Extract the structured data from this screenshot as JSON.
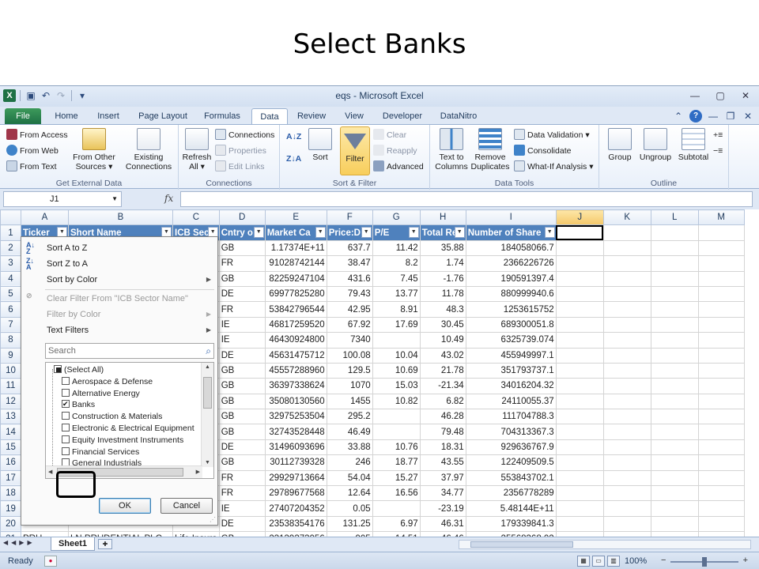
{
  "slide_title": "Select Banks",
  "window": {
    "title": "eqs - Microsoft Excel"
  },
  "ribbon_tabs": [
    "File",
    "Home",
    "Insert",
    "Page Layout",
    "Formulas",
    "Data",
    "Review",
    "View",
    "Developer",
    "DataNitro"
  ],
  "active_tab": "Data",
  "ribbon": {
    "get_external": {
      "label": "Get External Data",
      "from_access": "From Access",
      "from_web": "From Web",
      "from_text": "From Text",
      "from_other_1": "From Other",
      "from_other_2": "Sources ▾",
      "existing_1": "Existing",
      "existing_2": "Connections"
    },
    "connections": {
      "label": "Connections",
      "refresh_1": "Refresh",
      "refresh_2": "All ▾",
      "connections": "Connections",
      "properties": "Properties",
      "edit_links": "Edit Links"
    },
    "sort_filter": {
      "label": "Sort & Filter",
      "sort": "Sort",
      "filter": "Filter",
      "clear": "Clear",
      "reapply": "Reapply",
      "advanced": "Advanced"
    },
    "data_tools": {
      "label": "Data Tools",
      "text_to_1": "Text to",
      "text_to_2": "Columns",
      "remove_1": "Remove",
      "remove_2": "Duplicates",
      "data_validation": "Data Validation ▾",
      "consolidate": "Consolidate",
      "what_if": "What-If Analysis ▾"
    },
    "outline": {
      "label": "Outline",
      "group": "Group",
      "ungroup": "Ungroup",
      "subtotal": "Subtotal"
    }
  },
  "formula_bar": {
    "name_box": "J1",
    "fx": "fx",
    "value": ""
  },
  "columns": [
    "A",
    "B",
    "C",
    "D",
    "E",
    "F",
    "G",
    "H",
    "I",
    "J",
    "K",
    "L",
    "M"
  ],
  "header_row": [
    "Ticker",
    "Short Name",
    "ICB Sec",
    "Cntry o",
    "Market Ca",
    "Price:D",
    "P/E",
    "Total Re",
    "Number of Share"
  ],
  "rows": [
    [
      "",
      "",
      "",
      "GB",
      "1.17374E+11",
      "637.7",
      "11.42",
      "35.88",
      "184058066.7"
    ],
    [
      "",
      "",
      "",
      "FR",
      "91028742144",
      "38.47",
      "8.2",
      "1.74",
      "2366226726"
    ],
    [
      "",
      "",
      "",
      "GB",
      "82259247104",
      "431.6",
      "7.45",
      "-1.76",
      "190591397.4"
    ],
    [
      "",
      "",
      "",
      "DE",
      "69977825280",
      "79.43",
      "13.77",
      "11.78",
      "880999940.6"
    ],
    [
      "",
      "",
      "",
      "FR",
      "53842796544",
      "42.95",
      "8.91",
      "48.3",
      "1253615752"
    ],
    [
      "",
      "",
      "",
      "IE",
      "46817259520",
      "67.92",
      "17.69",
      "30.45",
      "689300051.8"
    ],
    [
      "",
      "",
      "",
      "IE",
      "46430924800",
      "7340",
      "",
      "10.49",
      "6325739.074"
    ],
    [
      "",
      "",
      "",
      "DE",
      "45631475712",
      "100.08",
      "10.04",
      "43.02",
      "455949997.1"
    ],
    [
      "",
      "",
      "",
      "GB",
      "45557288960",
      "129.5",
      "10.69",
      "21.78",
      "351793737.1"
    ],
    [
      "",
      "",
      "",
      "GB",
      "36397338624",
      "1070",
      "15.03",
      "-21.34",
      "34016204.32"
    ],
    [
      "",
      "",
      "",
      "GB",
      "35080130560",
      "1455",
      "10.82",
      "6.82",
      "24110055.37"
    ],
    [
      "",
      "",
      "",
      "GB",
      "32975253504",
      "295.2",
      "",
      "46.28",
      "111704788.3"
    ],
    [
      "",
      "",
      "",
      "GB",
      "32743528448",
      "46.49",
      "",
      "79.48",
      "704313367.3"
    ],
    [
      "",
      "",
      "",
      "DE",
      "31496093696",
      "33.88",
      "10.76",
      "18.31",
      "929636767.9"
    ],
    [
      "",
      "",
      "",
      "GB",
      "30112739328",
      "246",
      "18.77",
      "43.55",
      "122409509.5"
    ],
    [
      "",
      "",
      "",
      "FR",
      "29929713664",
      "54.04",
      "15.27",
      "37.97",
      "553843702.1"
    ],
    [
      "",
      "",
      "",
      "FR",
      "29789677568",
      "12.64",
      "16.56",
      "34.77",
      "2356778289"
    ],
    [
      "",
      "",
      "",
      "IE",
      "27407204352",
      "0.05",
      "",
      "-23.19",
      "5.48144E+11"
    ],
    [
      "",
      "",
      "",
      "DE",
      "23538354176",
      "131.25",
      "6.97",
      "46.31",
      "179339841.3"
    ],
    [
      "PRU",
      "LN PRUDENTIAL PLC",
      "Life Insura",
      "GB",
      "23139373056",
      "905",
      "14.51",
      "46.46",
      "25568368.02"
    ]
  ],
  "filter_menu": {
    "sort_az": "Sort A to Z",
    "sort_za": "Sort Z to A",
    "sort_color": "Sort by Color",
    "clear_filter": "Clear Filter From \"ICB Sector Name\"",
    "filter_color": "Filter by Color",
    "text_filters": "Text Filters",
    "search_placeholder": "Search",
    "items": [
      {
        "label": "(Select All)",
        "state": "partial"
      },
      {
        "label": "Aerospace & Defense",
        "state": "unchecked"
      },
      {
        "label": "Alternative Energy",
        "state": "unchecked"
      },
      {
        "label": "Banks",
        "state": "checked"
      },
      {
        "label": "Construction & Materials",
        "state": "unchecked"
      },
      {
        "label": "Electronic & Electrical Equipment",
        "state": "unchecked"
      },
      {
        "label": "Equity Investment Instruments",
        "state": "unchecked"
      },
      {
        "label": "Financial Services",
        "state": "unchecked"
      },
      {
        "label": "General Industrials",
        "state": "unchecked"
      }
    ],
    "ok": "OK",
    "cancel": "Cancel"
  },
  "sheet_tabs": [
    "Sheet1"
  ],
  "status": {
    "ready": "Ready",
    "zoom": "100%"
  }
}
